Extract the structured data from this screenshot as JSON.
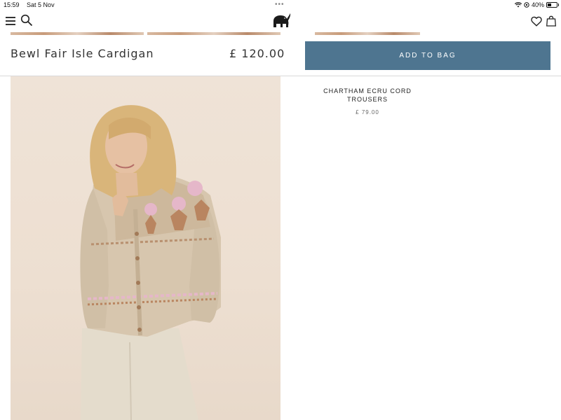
{
  "status_bar": {
    "time": "15:59",
    "date": "Sat 5 Nov",
    "battery": "40%",
    "dots": "•••"
  },
  "header": {
    "menu_icon": "hamburger-menu-icon",
    "search_icon": "search-icon",
    "logo_icon": "elephant-logo-icon",
    "wishlist_icon": "heart-icon",
    "bag_icon": "shopping-bag-icon"
  },
  "product": {
    "name": "Bewl Fair Isle Cardigan",
    "price": "£ 120.00",
    "add_to_bag_label": "ADD TO BAG",
    "button_color": "#4e7590"
  },
  "related": {
    "name": "CHARTHAM ECRU CORD TROUSERS",
    "price": "£ 79.00"
  }
}
